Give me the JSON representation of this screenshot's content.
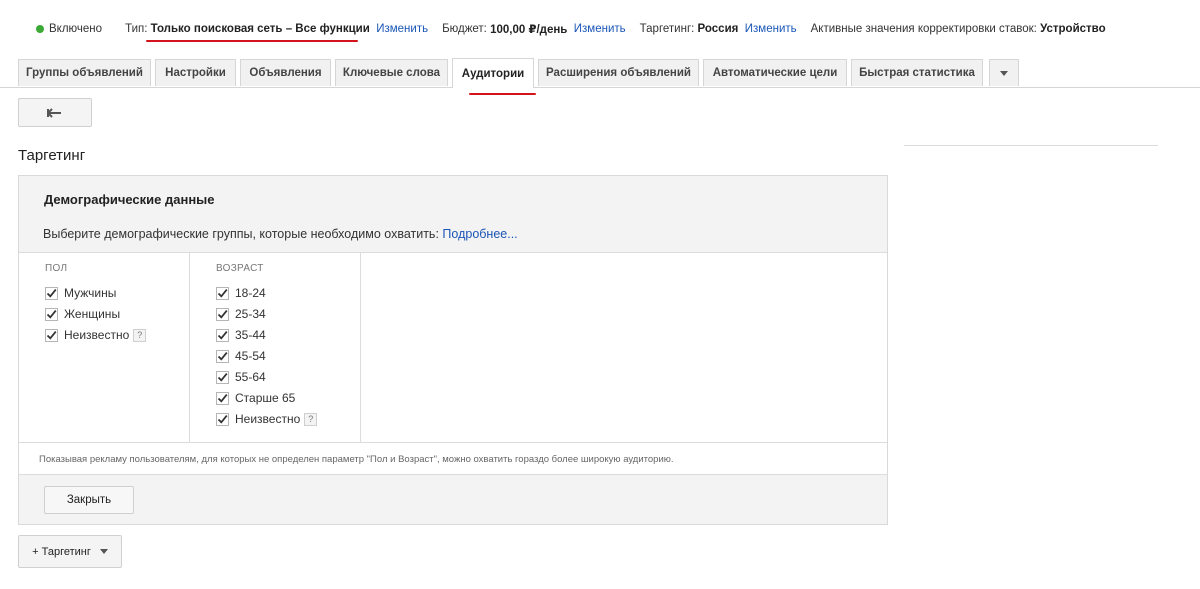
{
  "status_bar": {
    "state": "Включено",
    "type_label": "Тип:",
    "type_value": "Только поисковая сеть – Все функции",
    "type_change": "Изменить",
    "budget_label": "Бюджет:",
    "budget_value": "100,00 ₽/день",
    "budget_change": "Изменить",
    "targeting_label": "Таргетинг:",
    "targeting_value": "Россия",
    "targeting_change": "Изменить",
    "bid_adj_label": "Активные значения корректировки ставок:",
    "bid_adj_value": "Устройство",
    "colors": {
      "status_green": "#3aaa35",
      "link": "#1a56b7",
      "highlight_underline": "#d4141c"
    }
  },
  "tabs": [
    {
      "label": "Группы объявлений"
    },
    {
      "label": "Настройки"
    },
    {
      "label": "Объявления"
    },
    {
      "label": "Ключевые слова"
    },
    {
      "label": "Аудитории",
      "active": true
    },
    {
      "label": "Расширения объявлений"
    },
    {
      "label": "Автоматические цели"
    },
    {
      "label": "Быстрая статистика"
    }
  ],
  "tabs_more_icon": "chevron-down-icon",
  "back_icon": "back-arrow-icon",
  "page_title": "Таргетинг",
  "demographics": {
    "title": "Демографические данные",
    "description": "Выберите демографические группы, которые необходимо охватить:",
    "more_link": "Подробнее...",
    "gender": {
      "heading": "ПОЛ",
      "items": [
        {
          "label": "Мужчины",
          "checked": true
        },
        {
          "label": "Женщины",
          "checked": true
        },
        {
          "label": "Неизвестно",
          "checked": true,
          "help": "?"
        }
      ]
    },
    "age": {
      "heading": "ВОЗРАСТ",
      "items": [
        {
          "label": "18-24",
          "checked": true
        },
        {
          "label": "25-34",
          "checked": true
        },
        {
          "label": "35-44",
          "checked": true
        },
        {
          "label": "45-54",
          "checked": true
        },
        {
          "label": "55-64",
          "checked": true
        },
        {
          "label": "Старше 65",
          "checked": true
        },
        {
          "label": "Неизвестно",
          "checked": true,
          "help": "?"
        }
      ]
    },
    "note": "Показывая рекламу пользователям, для которых не определен параметр \"Пол и Возраст\", можно охватить гораздо более широкую аудиторию.",
    "close_label": "Закрыть"
  },
  "add_targeting_label": "+ Таргетинг"
}
